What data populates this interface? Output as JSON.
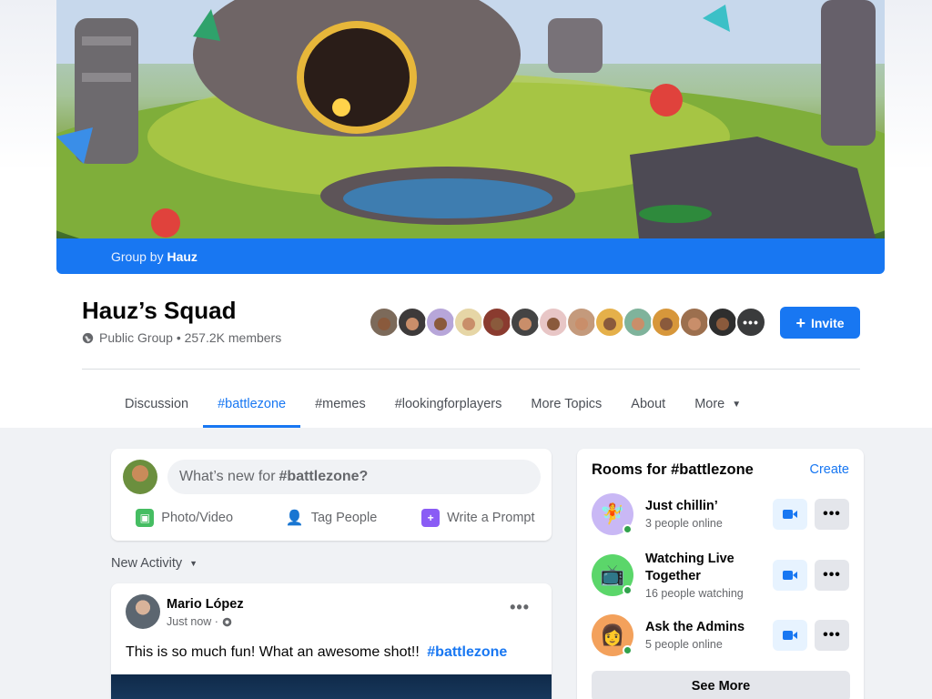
{
  "group": {
    "by_prefix": "Group by",
    "by_name": "Hauz",
    "name": "Hauz’s Squad",
    "meta": "Public Group • 257.2K members",
    "invite_label": "Invite"
  },
  "members": {
    "avatar_colors": [
      "#7c6a5a",
      "#3d3a3a",
      "#b7a6d9",
      "#e6d6a6",
      "#8a3b2f",
      "#444",
      "#e8c6c6",
      "#c49a7c",
      "#e5b04a",
      "#7fb39b",
      "#d7973b",
      "#9c6f4e",
      "#2e2e2e"
    ],
    "more_label": "•••"
  },
  "tabs": [
    {
      "label": "Discussion"
    },
    {
      "label": "#battlezone"
    },
    {
      "label": "#memes"
    },
    {
      "label": "#lookingforplayers"
    },
    {
      "label": "More Topics"
    },
    {
      "label": "About"
    },
    {
      "label": "More"
    }
  ],
  "composer": {
    "placeholder_prefix": "What’s new for",
    "placeholder_tag": "#battlezone?",
    "actions": [
      {
        "label": "Photo/Video",
        "icon": "photo-icon"
      },
      {
        "label": "Tag People",
        "icon": "tag-people-icon"
      },
      {
        "label": "Write a Prompt",
        "icon": "prompt-icon"
      }
    ]
  },
  "feed": {
    "sort_label": "New Activity"
  },
  "post": {
    "author": "Mario López",
    "time": "Just now ·",
    "text": "This is so much fun! What an awesome shot!!",
    "tag": "#battlezone",
    "menu": "•••"
  },
  "rooms": {
    "title": "Rooms for #battlezone",
    "create_label": "Create",
    "items": [
      {
        "name": "Just chillin’",
        "status": "3 people online",
        "color": "#c9b8f5",
        "icon": "fairy-icon"
      },
      {
        "name_line1": "Watching Live",
        "name_line2": "Together",
        "status": "16 people watching",
        "color": "#5bd66a",
        "icon": "tv-icon"
      },
      {
        "name": "Ask the Admins",
        "status": "5 people online",
        "color": "#f3a15c",
        "icon": "admin-avatar-icon"
      }
    ],
    "more_label": "•••",
    "see_more_label": "See More"
  },
  "colors": {
    "accent": "#1877f2",
    "online": "#31a24c"
  }
}
